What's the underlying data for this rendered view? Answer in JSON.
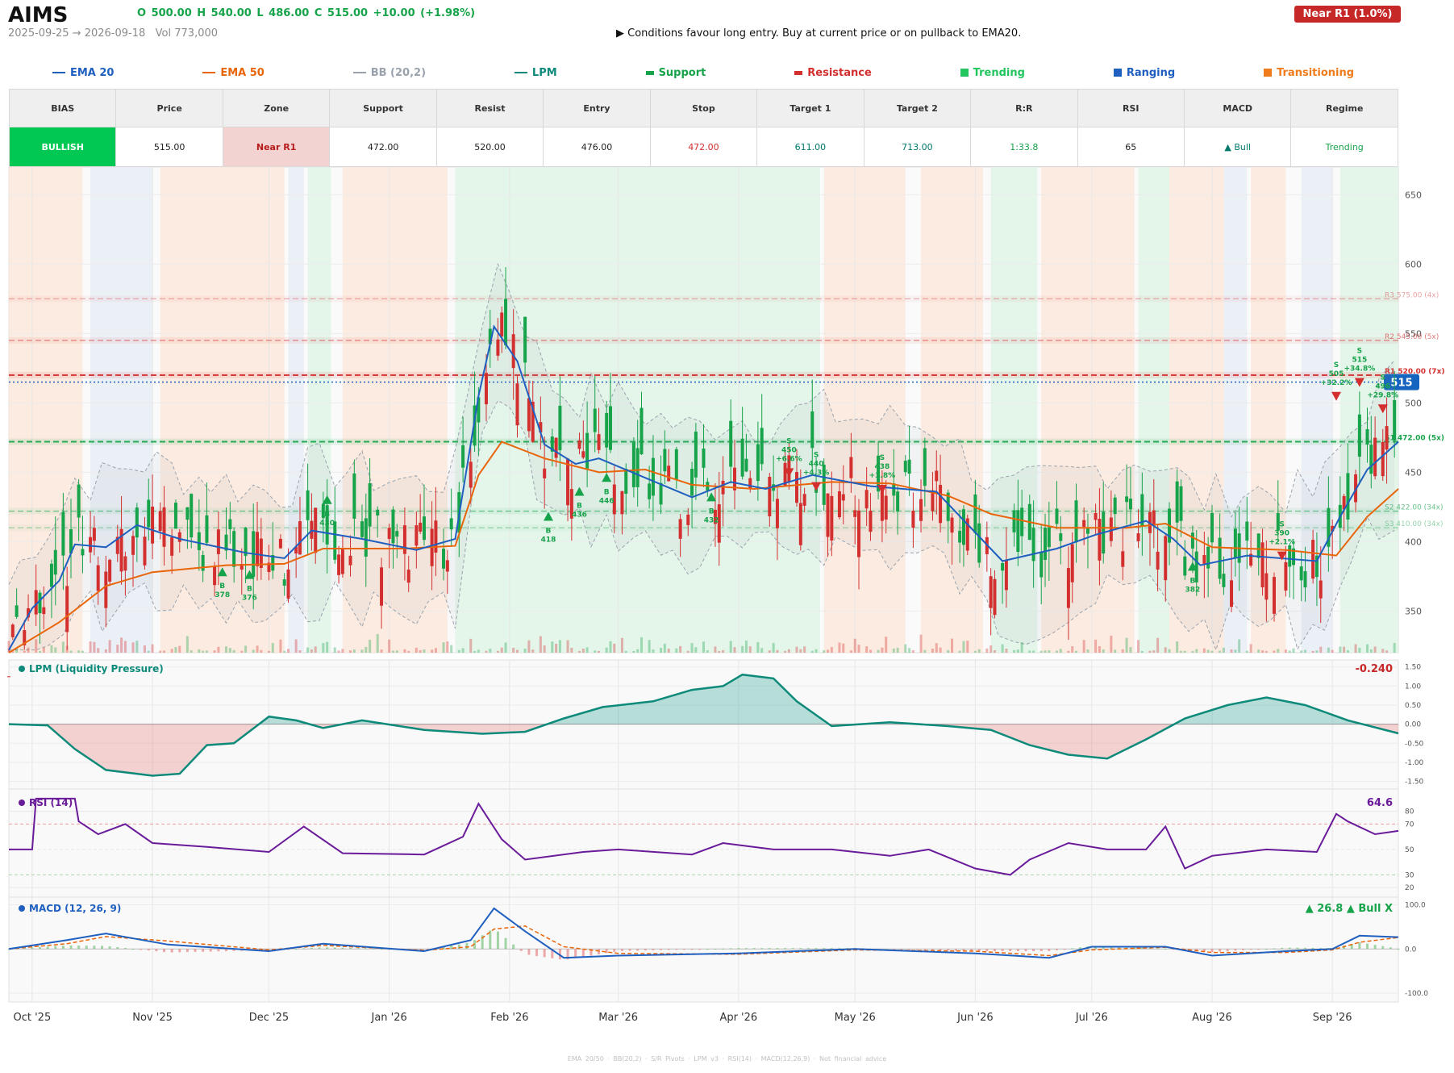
{
  "header": {
    "ticker": "AIMS",
    "ohlc": "O 500.00   H 540.00   L 486.00   C 515.00   +10.00  (+1.98%)",
    "date_range": "2025-09-25 → 2026-09-18",
    "volume": "Vol 773,000",
    "signal": "▶  Conditions favour long entry. Buy at current price or on pullback to EMA20.",
    "badge": "Near R1  (1.0%)"
  },
  "legend": [
    {
      "label": "EMA 20",
      "color": "#1f5fbf",
      "kind": "line"
    },
    {
      "label": "EMA 50",
      "color": "#e8650a",
      "kind": "line"
    },
    {
      "label": "BB (20,2)",
      "color": "#9aa3ad",
      "kind": "line"
    },
    {
      "label": "LPM",
      "color": "#0d8a7a",
      "kind": "line"
    },
    {
      "label": "Support",
      "color": "#16a34a",
      "kind": "dash"
    },
    {
      "label": "Resistance",
      "color": "#d32f2f",
      "kind": "dash"
    },
    {
      "label": "Trending",
      "color": "#22c55e",
      "kind": "square"
    },
    {
      "label": "Ranging",
      "color": "#1f5fbf",
      "kind": "square"
    },
    {
      "label": "Transitioning",
      "color": "#f07b1b",
      "kind": "square"
    }
  ],
  "table": {
    "headers": [
      "BIAS",
      "Price",
      "Zone",
      "Support",
      "Resist",
      "Entry",
      "Stop",
      "Target 1",
      "Target 2",
      "R:R",
      "RSI",
      "MACD",
      "Regime"
    ],
    "values": [
      "BULLISH",
      "515.00",
      "Near R1",
      "472.00",
      "520.00",
      "476.00",
      "472.00",
      "611.00",
      "713.00",
      "1:33.8",
      "65",
      "▲ Bull",
      "Trending"
    ]
  },
  "colors": {
    "bull": "#16a34a",
    "bear": "#d32f2f",
    "ema20": "#1f5fbf",
    "ema50": "#e8650a",
    "lpm": "#0d8a7a",
    "rsi": "#6a1b9a",
    "macd": "#1f5fbf",
    "signal": "#e8650a",
    "trend_band": "#dff3e6",
    "range_band": "#e7ecf5",
    "trans_band": "#fbe7da"
  },
  "footer": "EMA 20/50  ·  BB(20,2)  ·  S/R Pivots  ·  LPM v3  ·  RSI(14)  ·  MACD(12,26,9)  ·  Not financial advice",
  "chart_data": [
    {
      "type": "candlestick",
      "title": "AIMS",
      "x_range": [
        "2025-09-25",
        "2026-09-18"
      ],
      "ylim": [
        320,
        670
      ],
      "y_ticks": [
        350,
        400,
        450,
        500,
        550,
        600,
        650
      ],
      "x_ticks": [
        "Oct '25",
        "Nov '25",
        "Dec '25",
        "Jan '26",
        "Feb '26",
        "Mar '26",
        "Apr '26",
        "May '26",
        "Jun '26",
        "Jul '26",
        "Aug '26",
        "Sep '26"
      ],
      "last_price": 515,
      "last_price_label": "515",
      "levels": [
        {
          "label": "R3 575.00 (4x)",
          "price": 575,
          "kind": "resistance",
          "strength": 1
        },
        {
          "label": "R2 545.00 (5x)",
          "price": 545,
          "kind": "resistance",
          "strength": 2
        },
        {
          "label": "R1 520.00 (7x)",
          "price": 520,
          "kind": "resistance",
          "strength": 3
        },
        {
          "label": "S1 472.00 (5x)",
          "price": 472,
          "kind": "support",
          "strength": 3
        },
        {
          "label": "S2 422.00 (34x)",
          "price": 422,
          "kind": "support",
          "strength": 2
        },
        {
          "label": "S3 410.00 (34x)",
          "price": 410,
          "kind": "support",
          "strength": 1
        }
      ],
      "regimes": [
        {
          "from": "2025-09-25",
          "to": "2025-10-14",
          "regime": "Transitioning"
        },
        {
          "from": "2025-10-16",
          "to": "2025-11-01",
          "regime": "Ranging"
        },
        {
          "from": "2025-11-03",
          "to": "2025-12-05",
          "regime": "Transitioning"
        },
        {
          "from": "2025-12-06",
          "to": "2025-12-10",
          "regime": "Ranging"
        },
        {
          "from": "2025-12-11",
          "to": "2025-12-17",
          "regime": "Trending"
        },
        {
          "from": "2025-12-20",
          "to": "2026-01-16",
          "regime": "Transitioning"
        },
        {
          "from": "2026-01-18",
          "to": "2026-02-26",
          "regime": "Trending"
        },
        {
          "from": "2026-02-26",
          "to": "2026-04-22",
          "regime": "Trending"
        },
        {
          "from": "2026-04-23",
          "to": "2026-05-14",
          "regime": "Transitioning"
        },
        {
          "from": "2026-05-18",
          "to": "2026-06-03",
          "regime": "Transitioning"
        },
        {
          "from": "2026-06-05",
          "to": "2026-06-17",
          "regime": "Trending"
        },
        {
          "from": "2026-06-18",
          "to": "2026-07-12",
          "regime": "Transitioning"
        },
        {
          "from": "2026-07-13",
          "to": "2026-07-21",
          "regime": "Trending"
        },
        {
          "from": "2026-07-21",
          "to": "2026-08-04",
          "regime": "Transitioning"
        },
        {
          "from": "2026-08-04",
          "to": "2026-08-10",
          "regime": "Ranging"
        },
        {
          "from": "2026-08-11",
          "to": "2026-08-20",
          "regime": "Transitioning"
        },
        {
          "from": "2026-08-24",
          "to": "2026-09-01",
          "regime": "Ranging"
        },
        {
          "from": "2026-09-03",
          "to": "2026-09-18",
          "regime": "Trending"
        }
      ],
      "ema20": [
        [
          "2025-09-25",
          322
        ],
        [
          "2025-10-01",
          352
        ],
        [
          "2025-10-08",
          372
        ],
        [
          "2025-10-12",
          398
        ],
        [
          "2025-10-20",
          396
        ],
        [
          "2025-10-28",
          412
        ],
        [
          "2025-11-08",
          402
        ],
        [
          "2025-11-25",
          392
        ],
        [
          "2025-12-05",
          388
        ],
        [
          "2025-12-12",
          408
        ],
        [
          "2025-12-25",
          402
        ],
        [
          "2026-01-08",
          394
        ],
        [
          "2026-01-18",
          402
        ],
        [
          "2026-01-24",
          505
        ],
        [
          "2026-01-28",
          555
        ],
        [
          "2026-02-03",
          530
        ],
        [
          "2026-02-10",
          470
        ],
        [
          "2026-02-18",
          456
        ],
        [
          "2026-02-24",
          460
        ],
        [
          "2026-03-08",
          446
        ],
        [
          "2026-03-20",
          432
        ],
        [
          "2026-03-30",
          443
        ],
        [
          "2026-04-08",
          438
        ],
        [
          "2026-04-20",
          448
        ],
        [
          "2026-05-05",
          440
        ],
        [
          "2026-05-22",
          436
        ],
        [
          "2026-06-08",
          386
        ],
        [
          "2026-06-22",
          395
        ],
        [
          "2026-07-02",
          405
        ],
        [
          "2026-07-15",
          415
        ],
        [
          "2026-07-22",
          402
        ],
        [
          "2026-07-29",
          383
        ],
        [
          "2026-08-10",
          390
        ],
        [
          "2026-08-28",
          386
        ],
        [
          "2026-09-03",
          418
        ],
        [
          "2026-09-10",
          452
        ],
        [
          "2026-09-18",
          472
        ]
      ],
      "ema50": [
        [
          "2025-09-25",
          320
        ],
        [
          "2025-10-08",
          342
        ],
        [
          "2025-10-20",
          368
        ],
        [
          "2025-11-01",
          378
        ],
        [
          "2025-11-20",
          383
        ],
        [
          "2025-12-05",
          384
        ],
        [
          "2025-12-15",
          395
        ],
        [
          "2026-01-05",
          395
        ],
        [
          "2026-01-18",
          397
        ],
        [
          "2026-01-24",
          448
        ],
        [
          "2026-01-30",
          472
        ],
        [
          "2026-02-10",
          460
        ],
        [
          "2026-02-24",
          450
        ],
        [
          "2026-03-08",
          452
        ],
        [
          "2026-03-20",
          441
        ],
        [
          "2026-04-05",
          438
        ],
        [
          "2026-04-25",
          443
        ],
        [
          "2026-05-10",
          442
        ],
        [
          "2026-05-25",
          433
        ],
        [
          "2026-06-05",
          420
        ],
        [
          "2026-06-22",
          410
        ],
        [
          "2026-07-10",
          410
        ],
        [
          "2026-07-20",
          413
        ],
        [
          "2026-08-01",
          396
        ],
        [
          "2026-08-20",
          394
        ],
        [
          "2026-09-02",
          390
        ],
        [
          "2026-09-10",
          418
        ],
        [
          "2026-09-18",
          438
        ]
      ],
      "trades": [
        {
          "side": "B",
          "price": 378,
          "date": "2025-11-19",
          "label": "B 378"
        },
        {
          "side": "B",
          "price": 376,
          "date": "2025-11-26",
          "label": "B 376"
        },
        {
          "side": "B",
          "price": 430,
          "date": "2025-12-16",
          "label": "B 430"
        },
        {
          "side": "B",
          "price": 418,
          "date": "2026-02-11",
          "label": "B 418"
        },
        {
          "side": "B",
          "price": 436,
          "date": "2026-02-19",
          "label": "B 436"
        },
        {
          "side": "B",
          "price": 446,
          "date": "2026-02-26",
          "label": "B 446"
        },
        {
          "side": "S",
          "price": 450,
          "date": "2026-04-14",
          "label": "S 450 +6.6%"
        },
        {
          "side": "S",
          "price": 440,
          "date": "2026-04-21",
          "label": "S 440 +4.3%"
        },
        {
          "side": "B",
          "price": 432,
          "date": "2026-03-25",
          "label": "B 432"
        },
        {
          "side": "S",
          "price": 438,
          "date": "2026-05-08",
          "label": "S 438 +3.8%"
        },
        {
          "side": "B",
          "price": 382,
          "date": "2026-07-27",
          "label": "B 382"
        },
        {
          "side": "S",
          "price": 390,
          "date": "2026-08-19",
          "label": "S 390 +2.1%"
        },
        {
          "side": "S",
          "price": 505,
          "date": "2026-09-02",
          "label": "S 505 +32.2%"
        },
        {
          "side": "S",
          "price": 515,
          "date": "2026-09-08",
          "label": "S 515 +34.8%"
        },
        {
          "side": "S",
          "price": 496,
          "date": "2026-09-14",
          "label": "S 496 +29.8%"
        }
      ]
    },
    {
      "type": "area",
      "title": "LPM (Liquidity Pressure)",
      "last_value_label": "-0.240",
      "ylim": [
        -1.7,
        1.6
      ],
      "y_ticks": [
        "1.50",
        "1.00",
        "0.50",
        "0.00",
        "-0.50",
        "-1.00",
        "-1.50"
      ],
      "x": [
        "2025-09-25",
        "2025-10-05",
        "2025-10-12",
        "2025-10-20",
        "2025-11-01",
        "2025-11-08",
        "2025-11-15",
        "2025-11-22",
        "2025-12-01",
        "2025-12-08",
        "2025-12-15",
        "2025-12-25",
        "2026-01-10",
        "2026-01-25",
        "2026-02-05",
        "2026-02-15",
        "2026-02-25",
        "2026-03-10",
        "2026-03-20",
        "2026-03-28",
        "2026-04-02",
        "2026-04-10",
        "2026-04-16",
        "2026-04-25",
        "2026-05-10",
        "2026-05-25",
        "2026-06-05",
        "2026-06-15",
        "2026-06-25",
        "2026-07-05",
        "2026-07-15",
        "2026-07-25",
        "2026-08-05",
        "2026-08-15",
        "2026-08-25",
        "2026-09-05",
        "2026-09-18"
      ],
      "values": [
        0.0,
        -0.03,
        -0.65,
        -1.2,
        -1.35,
        -1.3,
        -0.55,
        -0.5,
        0.2,
        0.1,
        -0.1,
        0.1,
        -0.15,
        -0.25,
        -0.2,
        0.15,
        0.45,
        0.6,
        0.9,
        1.0,
        1.3,
        1.2,
        0.6,
        -0.05,
        0.05,
        -0.05,
        -0.15,
        -0.55,
        -0.8,
        -0.9,
        -0.4,
        0.15,
        0.5,
        0.7,
        0.5,
        0.1,
        -0.24
      ]
    },
    {
      "type": "line",
      "title": "RSI (14)",
      "last_value_label": "64.6",
      "ylim": [
        15,
        95
      ],
      "y_ticks": [
        80,
        70,
        50,
        30,
        20
      ],
      "x": [
        "2025-09-25",
        "2025-10-01",
        "2025-10-02",
        "2025-10-12",
        "2025-10-13",
        "2025-10-18",
        "2025-10-25",
        "2025-11-01",
        "2025-11-15",
        "2025-12-01",
        "2025-12-10",
        "2025-12-20",
        "2026-01-10",
        "2026-01-20",
        "2026-01-24",
        "2026-01-30",
        "2026-02-05",
        "2026-02-20",
        "2026-03-01",
        "2026-03-20",
        "2026-03-28",
        "2026-04-10",
        "2026-04-25",
        "2026-05-10",
        "2026-05-20",
        "2026-06-01",
        "2026-06-10",
        "2026-06-15",
        "2026-06-25",
        "2026-07-05",
        "2026-07-15",
        "2026-07-20",
        "2026-07-25",
        "2026-08-01",
        "2026-08-15",
        "2026-08-28",
        "2026-09-02",
        "2026-09-05",
        "2026-09-12",
        "2026-09-18"
      ],
      "values": [
        50,
        50,
        90,
        90,
        72,
        62,
        70,
        55,
        52,
        48,
        68,
        47,
        46,
        60,
        86,
        58,
        42,
        48,
        50,
        46,
        55,
        50,
        50,
        45,
        50,
        35,
        30,
        42,
        55,
        50,
        50,
        68,
        35,
        45,
        50,
        48,
        78,
        72,
        62,
        64.6
      ]
    },
    {
      "type": "line",
      "title": "MACD (12, 26, 9)",
      "last_value_label": "▲ 26.8 ▲ Bull X",
      "ylim": [
        -120,
        110
      ],
      "y_ticks": [
        "100.0",
        "0.0",
        "-100.0"
      ],
      "x": [
        "2025-09-25",
        "2025-10-10",
        "2025-10-20",
        "2025-11-05",
        "2025-12-01",
        "2025-12-15",
        "2026-01-10",
        "2026-01-22",
        "2026-01-28",
        "2026-02-05",
        "2026-02-15",
        "2026-03-01",
        "2026-04-01",
        "2026-05-01",
        "2026-06-01",
        "2026-06-20",
        "2026-07-01",
        "2026-07-20",
        "2026-08-01",
        "2026-08-20",
        "2026-09-01",
        "2026-09-08",
        "2026-09-18"
      ],
      "series": [
        {
          "name": "MACD",
          "values": [
            0,
            20,
            35,
            10,
            -5,
            12,
            -5,
            20,
            92,
            40,
            -20,
            -15,
            -10,
            0,
            -10,
            -20,
            5,
            5,
            -15,
            -5,
            0,
            30,
            26.8
          ]
        },
        {
          "name": "Signal",
          "values": [
            0,
            12,
            28,
            18,
            -2,
            8,
            -3,
            5,
            45,
            52,
            5,
            -10,
            -12,
            -2,
            -5,
            -15,
            -2,
            4,
            -8,
            -8,
            -2,
            15,
            26
          ]
        }
      ]
    }
  ]
}
